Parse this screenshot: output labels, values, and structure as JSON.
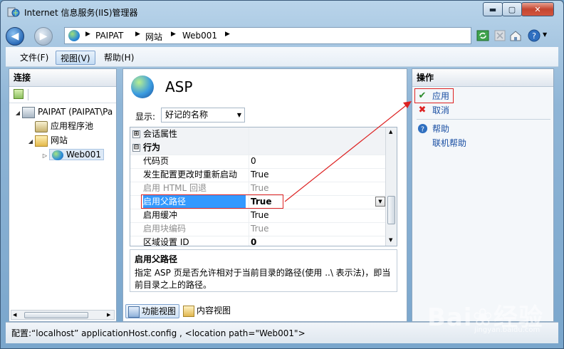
{
  "window": {
    "title": "Internet 信息服务(IIS)管理器",
    "controls": {
      "minimize": "▬",
      "maximize": "▢",
      "close": "✕"
    }
  },
  "nav": {
    "breadcrumb": [
      "PAIPAT",
      "网站",
      "Web001"
    ],
    "arrow": "▶",
    "icons": [
      "refresh-icon",
      "stop-icon",
      "home-icon",
      "help-icon"
    ]
  },
  "menu": {
    "file": "文件(F)",
    "view": "视图(V)",
    "help": "帮助(H)"
  },
  "connections": {
    "title": "连接",
    "tree": [
      {
        "label": "PAIPAT (PAIPAT\\Pa",
        "icon": "server-icon",
        "level": 0
      },
      {
        "label": "应用程序池",
        "icon": "app-pool-icon",
        "level": 1
      },
      {
        "label": "网站",
        "icon": "sites-folder-icon",
        "level": 1
      },
      {
        "label": "Web001",
        "icon": "globe-icon",
        "level": 2
      }
    ]
  },
  "feature": {
    "title": "ASP",
    "show_label": "显示:",
    "group_value": "好记的名称",
    "grid": [
      {
        "type": "category",
        "name": "会话属性",
        "value": "",
        "expander": "⊞"
      },
      {
        "type": "category",
        "name": "行为",
        "value": "",
        "expander": "⊟"
      },
      {
        "type": "prop",
        "name": "代码页",
        "value": "0"
      },
      {
        "type": "prop",
        "name": "发生配置更改时重新启动",
        "value": "True"
      },
      {
        "type": "disabled",
        "name": "启用 HTML 回退",
        "value": "True"
      },
      {
        "type": "selected",
        "name": "启用父路径",
        "value": "True"
      },
      {
        "type": "prop",
        "name": "启用缓冲",
        "value": "True"
      },
      {
        "type": "disabled",
        "name": "启用块编码",
        "value": "True"
      },
      {
        "type": "prop",
        "name": "区域设置 ID",
        "value": "0"
      }
    ],
    "description": {
      "title": "启用父路径",
      "text": "指定 ASP 页是否允许相对于当前目录的路径(使用 ..\\ 表示法)，即当前目录之上的路径。"
    },
    "tabs": {
      "feature_view": "功能视图",
      "content_view": "内容视图"
    }
  },
  "actions": {
    "title": "操作",
    "items": [
      {
        "label": "应用",
        "icon": "apply-icon"
      },
      {
        "label": "取消",
        "icon": "cancel-icon"
      },
      {
        "label": "帮助",
        "icon": "help-icon"
      },
      {
        "label": "联机帮助",
        "icon": ""
      }
    ]
  },
  "status": {
    "text": "配置:“localhost” applicationHost.config , <location path=\"Web001\">"
  },
  "watermark": {
    "brand": "Bai❀经验",
    "url": "jingyan.baidu.com"
  },
  "colors": {
    "selection": "#3399ff",
    "highlight_box": "#dd2222",
    "link": "#1a4fa3"
  }
}
